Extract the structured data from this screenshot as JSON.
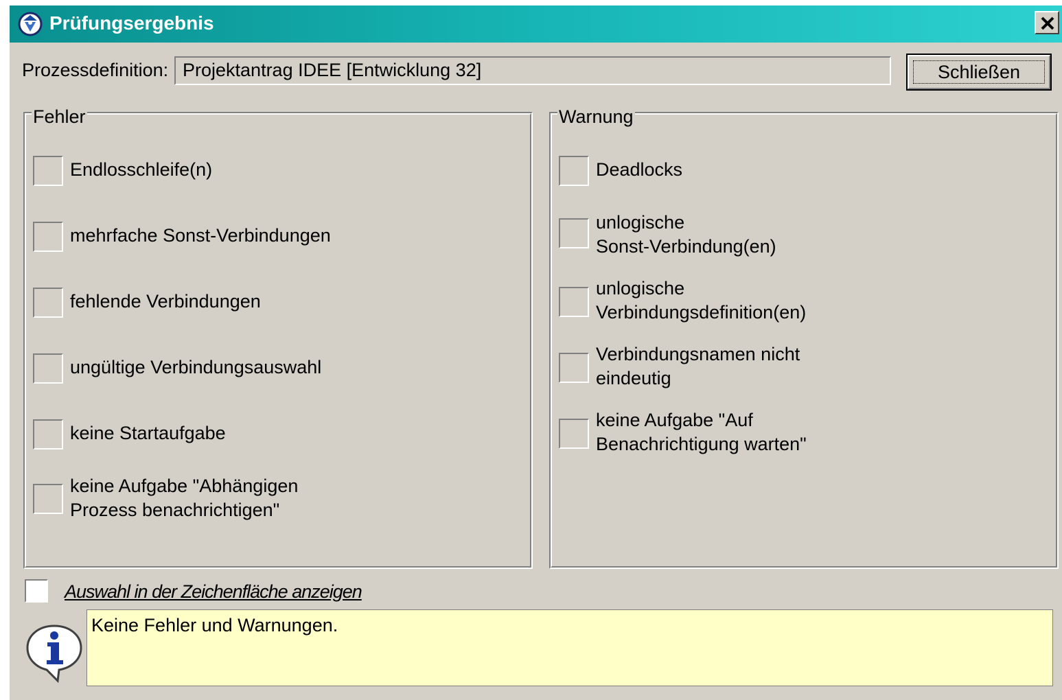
{
  "window": {
    "title": "Prüfungsergebnis",
    "title_gradient": [
      "#0a8f8f",
      "#2ed0d0"
    ],
    "icon": "process-check-icon",
    "close_glyph": "×"
  },
  "header": {
    "process_label": "Prozessdefinition:",
    "process_value": "Projektantrag IDEE [Entwicklung 32]",
    "close_button": "Schließen"
  },
  "errors": {
    "title": "Fehler",
    "items": [
      {
        "line1": "Endlosschleife(n)",
        "line2": ""
      },
      {
        "line1": "mehrfache Sonst-Verbindungen",
        "line2": ""
      },
      {
        "line1": "fehlende Verbindungen",
        "line2": ""
      },
      {
        "line1": "ungültige Verbindungsauswahl",
        "line2": ""
      },
      {
        "line1": "keine Startaufgabe",
        "line2": ""
      },
      {
        "line1": "keine Aufgabe \"Abhängigen",
        "line2": "Prozess benachrichtigen\""
      }
    ]
  },
  "warnings": {
    "title": "Warnung",
    "items": [
      {
        "line1": "Deadlocks",
        "line2": ""
      },
      {
        "line1": "unlogische",
        "line2": "Sonst-Verbindung(en)"
      },
      {
        "line1": "unlogische",
        "line2": "Verbindungsdefinition(en)"
      },
      {
        "line1": "Verbindungsnamen nicht",
        "line2": "eindeutig"
      },
      {
        "line1": "keine Aufgabe \"Auf",
        "line2": "Benachrichtigung warten\""
      }
    ]
  },
  "footer": {
    "show_selection_label": "Auswahl in der Zeichenfläche anzeigen",
    "show_selection_checked": false,
    "info_icon": "info-icon",
    "message": "Keine Fehler und Warnungen.",
    "message_bg": "#ffffc8"
  }
}
